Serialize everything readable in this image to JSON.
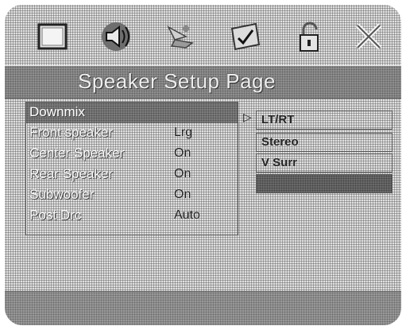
{
  "icons": [
    "general-setup-icon",
    "speaker-setup-icon",
    "audio-setup-icon",
    "preferences-icon",
    "password-icon",
    "exit-icon"
  ],
  "page_title": "Speaker Setup Page",
  "settings": [
    {
      "label": "Downmix",
      "value": "",
      "selected": true
    },
    {
      "label": "Front speaker",
      "value": "Lrg",
      "selected": false
    },
    {
      "label": "Center Speaker",
      "value": "On",
      "selected": false
    },
    {
      "label": "Rear Speaker",
      "value": "On",
      "selected": false
    },
    {
      "label": "Subwoofer",
      "value": "On",
      "selected": false
    },
    {
      "label": "Post Drc",
      "value": "Auto",
      "selected": false
    }
  ],
  "options": [
    {
      "label": "LT/RT",
      "highlighted": false
    },
    {
      "label": "Stereo",
      "highlighted": false
    },
    {
      "label": "V Surr",
      "highlighted": false
    },
    {
      "label": "",
      "highlighted": true
    }
  ],
  "status_bar": "",
  "colors": {
    "background": "#c9c9c9",
    "title_bar": "#8f8f8f",
    "selected_row": "#7e7e7e"
  }
}
